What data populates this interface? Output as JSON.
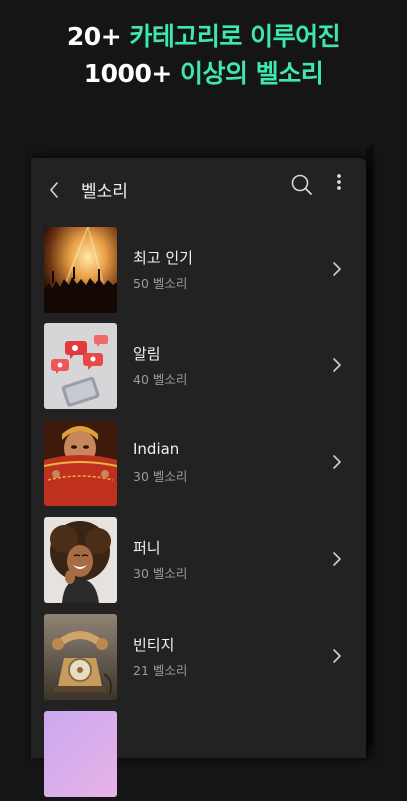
{
  "promo": {
    "line1_prefix": "20+ ",
    "line1_accent": "카테고리로 이루어진",
    "line2_prefix": "1000+ ",
    "line2_accent": "이상의 벨소리"
  },
  "appbar": {
    "title": "벨소리",
    "back_icon": "chevron-left-icon",
    "search_icon": "search-icon",
    "more_icon": "more-vertical-icon"
  },
  "categories": [
    {
      "name": "최고 인기",
      "count": "50 벨소리",
      "thumb": "concert-crowd"
    },
    {
      "name": "알림",
      "count": "40 벨소리",
      "thumb": "notification-phone"
    },
    {
      "name": "Indian",
      "count": "30 벨소리",
      "thumb": "indian-woman"
    },
    {
      "name": "퍼니",
      "count": "30 벨소리",
      "thumb": "laughing-woman"
    },
    {
      "name": "빈티지",
      "count": "21 벨소리",
      "thumb": "vintage-telephone"
    }
  ],
  "colors": {
    "accent": "#3ee6b0",
    "background": "#151515",
    "panel": "#222223"
  }
}
